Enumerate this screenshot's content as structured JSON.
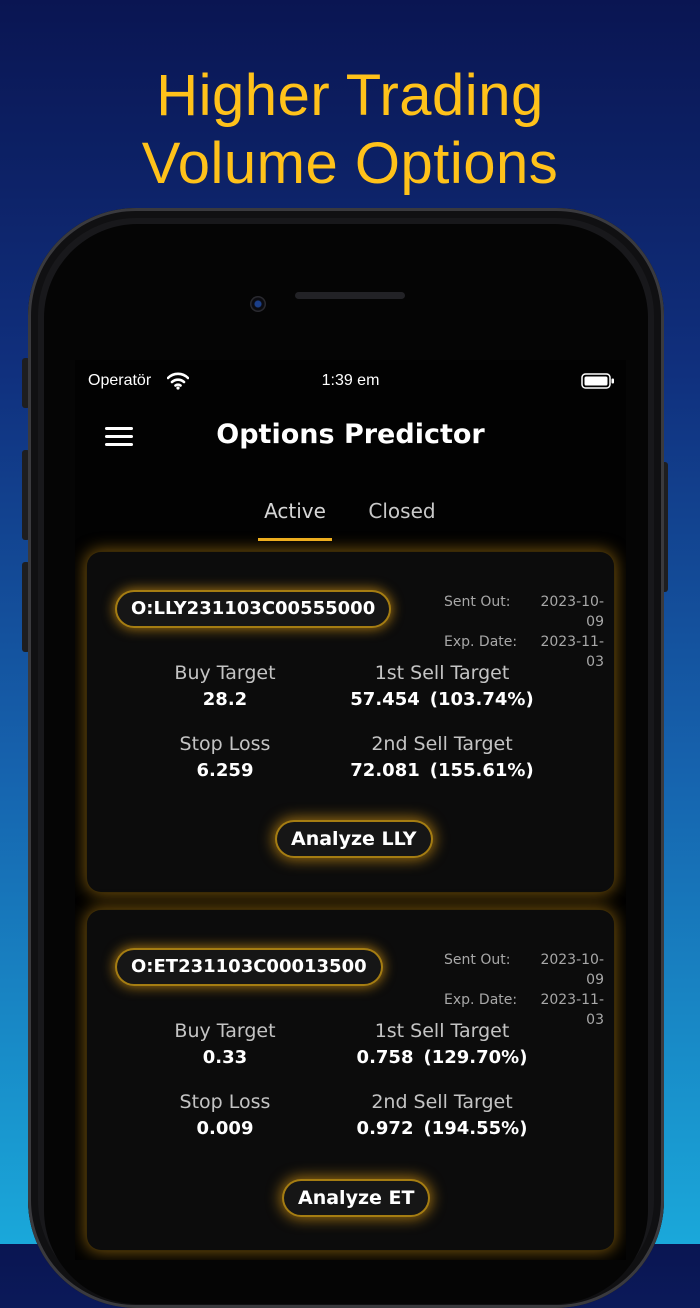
{
  "headline": {
    "line1": "Higher Trading",
    "line2": "Volume Options"
  },
  "status_bar": {
    "carrier": "Operatör",
    "time": "1:39 em"
  },
  "app": {
    "title": "Options Predictor"
  },
  "tabs": [
    {
      "label": "Active",
      "selected": true
    },
    {
      "label": "Closed",
      "selected": false
    }
  ],
  "colors": {
    "accent": "#f0b020",
    "headline": "#ffc21a",
    "background_top": "#0a1552",
    "background_bottom": "#1aa8da"
  },
  "cards": [
    {
      "symbol": "O:LLY231103C00555000",
      "sent_out_label": "Sent Out:",
      "sent_out": "2023-10-09",
      "exp_date_label": "Exp. Date:",
      "exp_date": "2023-11-03",
      "buy_target_label": "Buy Target",
      "buy_target": "28.2",
      "stop_loss_label": "Stop Loss",
      "stop_loss": "6.259",
      "sell1_label": "1st Sell Target",
      "sell1_value": "57.454",
      "sell1_pct": "(103.74%)",
      "sell2_label": "2nd Sell Target",
      "sell2_value": "72.081",
      "sell2_pct": "(155.61%)",
      "analyze_label": "Analyze LLY"
    },
    {
      "symbol": "O:ET231103C00013500",
      "sent_out_label": "Sent Out:",
      "sent_out": "2023-10-09",
      "exp_date_label": "Exp. Date:",
      "exp_date": "2023-11-03",
      "buy_target_label": "Buy Target",
      "buy_target": "0.33",
      "stop_loss_label": "Stop Loss",
      "stop_loss": "0.009",
      "sell1_label": "1st Sell Target",
      "sell1_value": "0.758",
      "sell1_pct": "(129.70%)",
      "sell2_label": "2nd Sell Target",
      "sell2_value": "0.972",
      "sell2_pct": "(194.55%)",
      "analyze_label": "Analyze ET"
    }
  ]
}
